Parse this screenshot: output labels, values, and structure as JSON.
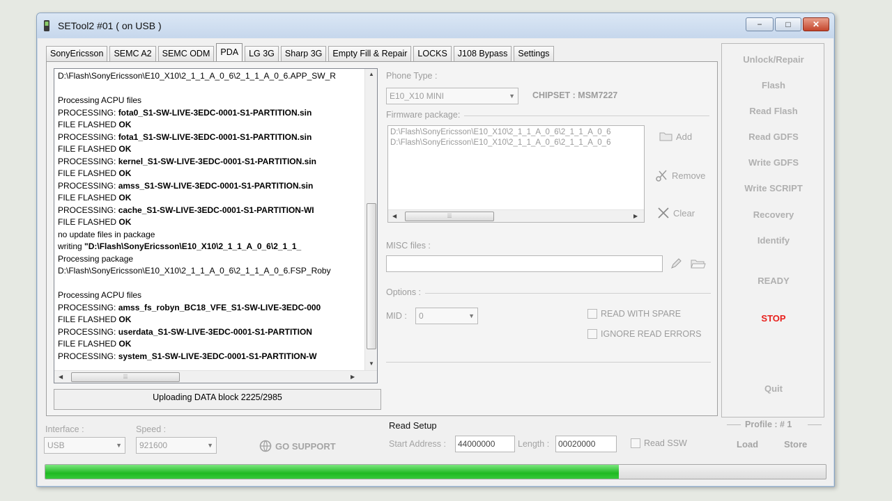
{
  "window": {
    "title": "SETool2 #01 ( on USB )"
  },
  "title_buttons": {
    "minimize": "−",
    "maximize": "□",
    "close": "✕"
  },
  "tabs": [
    "SonyEricsson",
    "SEMC A2",
    "SEMC ODM",
    "PDA",
    "LG 3G",
    "Sharp 3G",
    "Empty Fill & Repair",
    "LOCKS",
    "J108 Bypass",
    "Settings"
  ],
  "active_tab": "PDA",
  "log": [
    {
      "label": "D:\\Flash\\SonyEricsson\\E10_X10\\2_1_1_A_0_6\\2_1_1_A_0_6.APP_SW_R",
      "bold": ""
    },
    {
      "label": "",
      "bold": ""
    },
    {
      "label": "Processing ACPU files",
      "bold": ""
    },
    {
      "label": "PROCESSING: ",
      "bold": "fota0_S1-SW-LIVE-3EDC-0001-S1-PARTITION.sin"
    },
    {
      "label": "FILE FLASHED ",
      "bold": "OK"
    },
    {
      "label": "PROCESSING: ",
      "bold": "fota1_S1-SW-LIVE-3EDC-0001-S1-PARTITION.sin"
    },
    {
      "label": "FILE FLASHED ",
      "bold": "OK"
    },
    {
      "label": "PROCESSING: ",
      "bold": "kernel_S1-SW-LIVE-3EDC-0001-S1-PARTITION.sin"
    },
    {
      "label": "FILE FLASHED ",
      "bold": "OK"
    },
    {
      "label": "PROCESSING: ",
      "bold": "amss_S1-SW-LIVE-3EDC-0001-S1-PARTITION.sin"
    },
    {
      "label": "FILE FLASHED ",
      "bold": "OK"
    },
    {
      "label": "PROCESSING: ",
      "bold": "cache_S1-SW-LIVE-3EDC-0001-S1-PARTITION-WI"
    },
    {
      "label": "FILE FLASHED ",
      "bold": "OK"
    },
    {
      "label": "no update files in package",
      "bold": ""
    },
    {
      "label": "writing ",
      "bold": "\"D:\\Flash\\SonyEricsson\\E10_X10\\2_1_1_A_0_6\\2_1_1_"
    },
    {
      "label": "Processing package",
      "bold": ""
    },
    {
      "label": "D:\\Flash\\SonyEricsson\\E10_X10\\2_1_1_A_0_6\\2_1_1_A_0_6.FSP_Roby",
      "bold": ""
    },
    {
      "label": "",
      "bold": ""
    },
    {
      "label": "Processing ACPU files",
      "bold": ""
    },
    {
      "label": "PROCESSING: ",
      "bold": "amss_fs_robyn_BC18_VFE_S1-SW-LIVE-3EDC-000"
    },
    {
      "label": "FILE FLASHED ",
      "bold": "OK"
    },
    {
      "label": "PROCESSING: ",
      "bold": "userdata_S1-SW-LIVE-3EDC-0001-S1-PARTITION"
    },
    {
      "label": "FILE FLASHED ",
      "bold": "OK"
    },
    {
      "label": "PROCESSING: ",
      "bold": "system_S1-SW-LIVE-3EDC-0001-S1-PARTITION-W"
    }
  ],
  "log_status": "Uploading DATA block 2225/2985",
  "pda": {
    "phone_type_label": "Phone Type :",
    "phone_type_value": "E10_X10 MINI",
    "chipset": "CHIPSET : MSM7227",
    "firmware_label": "Firmware package:",
    "firmware_files": [
      "D:\\Flash\\SonyEricsson\\E10_X10\\2_1_1_A_0_6\\2_1_1_A_0_6",
      "D:\\Flash\\SonyEricsson\\E10_X10\\2_1_1_A_0_6\\2_1_1_A_0_6"
    ],
    "add": "Add",
    "remove": "Remove",
    "clear": "Clear",
    "misc_label": "MISC files :",
    "misc_value": "",
    "options_label": "Options :",
    "mid_label": "MID :",
    "mid_value": "0",
    "read_with_spare": "READ WITH SPARE",
    "ignore_read_errors": "IGNORE READ ERRORS"
  },
  "commands": {
    "unlock": "Unlock/Repair",
    "flash": "Flash",
    "read_flash": "Read Flash",
    "read_gdfs": "Read GDFS",
    "write_gdfs": "Write GDFS",
    "write_script": "Write SCRIPT",
    "recovery": "Recovery",
    "identify": "Identify",
    "ready": "READY",
    "stop": "STOP",
    "quit": "Quit",
    "profile": "Profile : # 1",
    "load": "Load",
    "store": "Store"
  },
  "bottom": {
    "interface_label": "Interface :",
    "interface_value": "USB",
    "speed_label": "Speed :",
    "speed_value": "921600",
    "go_support": "GO SUPPORT",
    "read_setup": "Read Setup",
    "start_address_label": "Start Address :",
    "start_address_value": "44000000",
    "length_label": "Length :",
    "length_value": "00020000",
    "read_ssw": "Read SSW"
  },
  "progress_fraction": 0.735
}
